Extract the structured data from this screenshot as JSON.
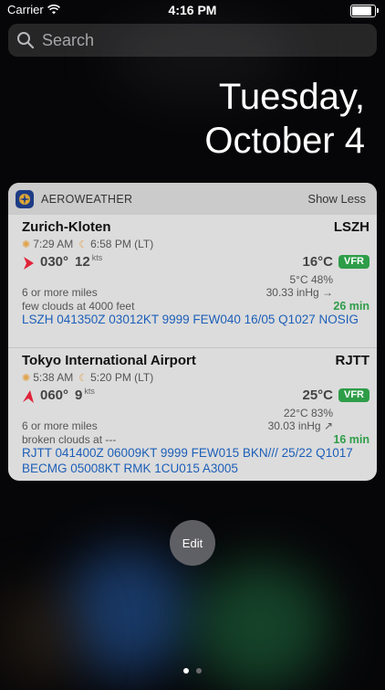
{
  "status_bar": {
    "carrier": "Carrier",
    "time": "4:16 PM",
    "battery_percent": 95
  },
  "search": {
    "placeholder": "Search"
  },
  "date": {
    "weekday": "Tuesday,",
    "month_day": "October 4"
  },
  "widget": {
    "app_name": "AEROWEATHER",
    "show_less_label": "Show Less",
    "airports": [
      {
        "name": "Zurich-Kloten",
        "code": "LSZH",
        "sunrise": "7:29 AM",
        "sunset": "6:58 PM (LT)",
        "wind_dir": "030°",
        "wind_speed": "12",
        "wind_unit": "kts",
        "temp": "16°C",
        "flight_rule": "VFR",
        "dew_humidity": "5°C 48%",
        "visibility": "6 or more miles",
        "pressure": "30.33 inHg →",
        "clouds": "few clouds at 4000 feet",
        "age": "26 min",
        "metar": "LSZH 041350Z 03012KT 9999 FEW040 16/05 Q1027 NOSIG"
      },
      {
        "name": "Tokyo International Airport",
        "code": "RJTT",
        "sunrise": "5:38 AM",
        "sunset": "5:20 PM (LT)",
        "wind_dir": "060°",
        "wind_speed": "9",
        "wind_unit": "kts",
        "temp": "25°C",
        "flight_rule": "VFR",
        "dew_humidity": "22°C 83%",
        "visibility": "6 or more miles",
        "pressure": "30.03 inHg ↗",
        "clouds": "broken clouds at ---",
        "age": "16 min",
        "metar": "RJTT 041400Z 06009KT 9999 FEW015 BKN/// 25/22 Q1017 BECMG 05008KT RMK 1CU015 A3005"
      }
    ]
  },
  "edit_label": "Edit",
  "pager": {
    "pages": 2,
    "current": 1
  },
  "colors": {
    "vfr_green": "#2e9d48",
    "metar_blue": "#1d5fb8",
    "wind_arrow_red": "#e0243a"
  }
}
